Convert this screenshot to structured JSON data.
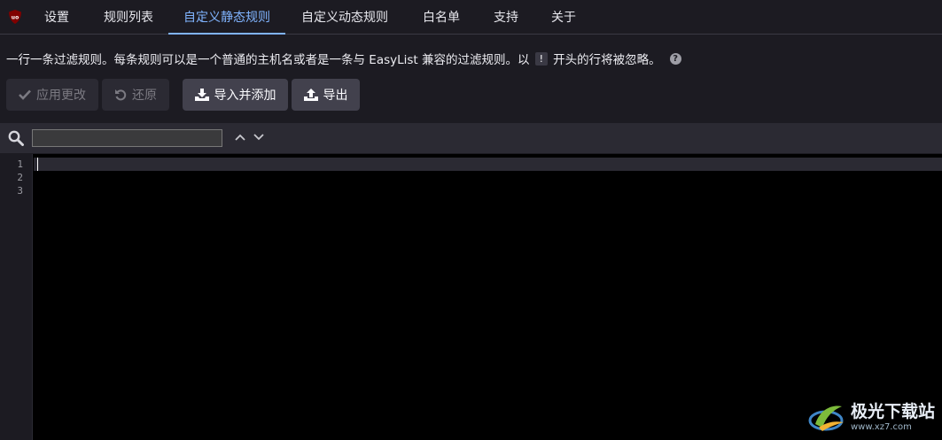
{
  "tabs": [
    {
      "label": "设置",
      "active": false
    },
    {
      "label": "规则列表",
      "active": false
    },
    {
      "label": "自定义静态规则",
      "active": true
    },
    {
      "label": "自定义动态规则",
      "active": false
    },
    {
      "label": "白名单",
      "active": false
    },
    {
      "label": "支持",
      "active": false
    },
    {
      "label": "关于",
      "active": false
    }
  ],
  "description": {
    "before": "一行一条过滤规则。每条规则可以是一个普通的主机名或者是一条与 EasyList 兼容的过滤规则。以",
    "kbd": "!",
    "after": "开头的行将被忽略。"
  },
  "buttons": {
    "apply": "应用更改",
    "revert": "还原",
    "import": "导入并添加",
    "export": "导出"
  },
  "search": {
    "value": ""
  },
  "editor": {
    "line_numbers": [
      "1",
      "2",
      "3"
    ]
  },
  "logo": {
    "text": "uo"
  },
  "watermark": {
    "title": "极光下载站",
    "subtitle": "www.xz7.com"
  },
  "colors": {
    "accent": "#80b4ff",
    "background": "#1c1b22",
    "button": "#42414d"
  }
}
